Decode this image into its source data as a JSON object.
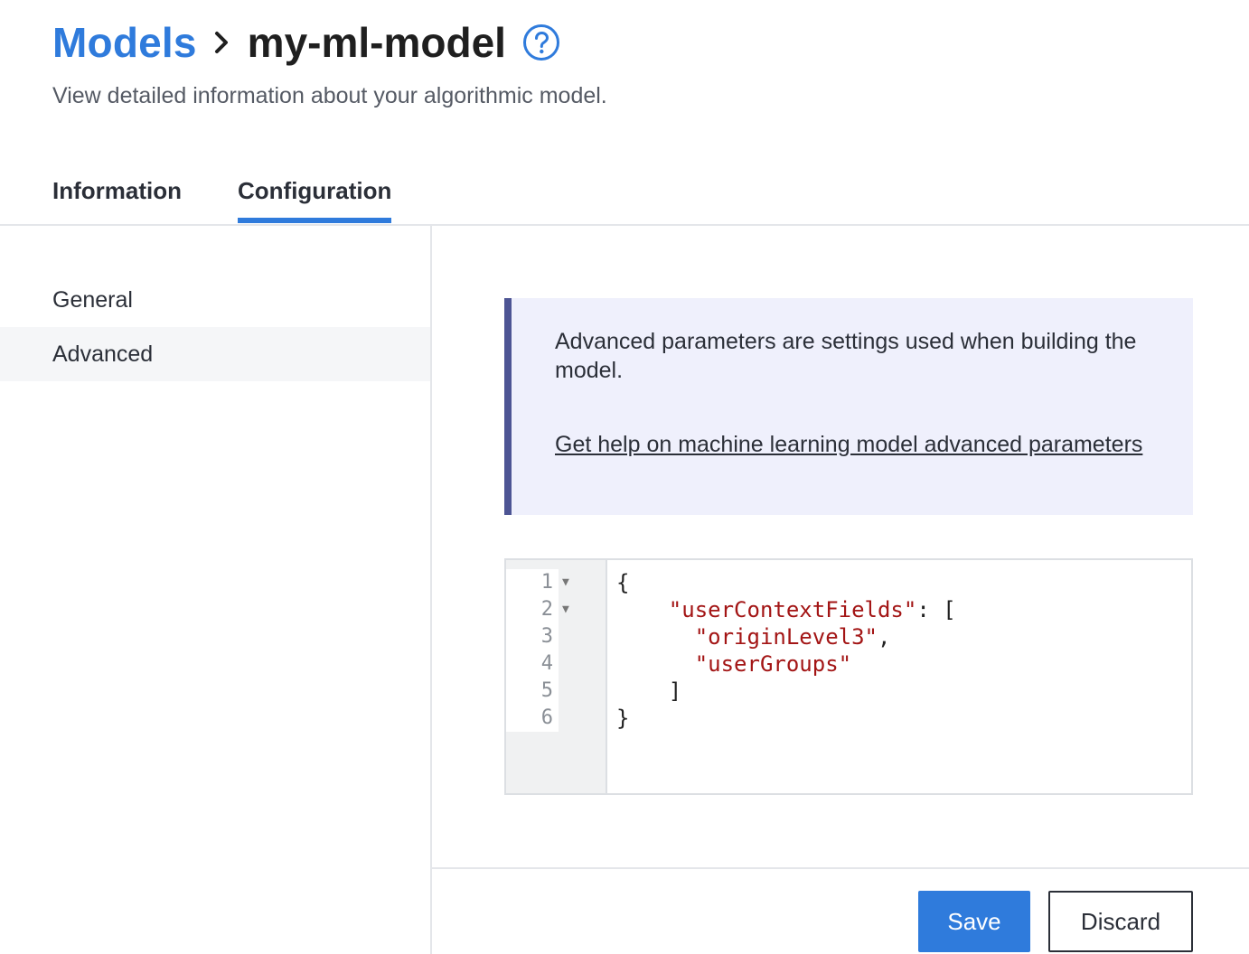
{
  "header": {
    "breadcrumb_root": "Models",
    "breadcrumb_current": "my-ml-model",
    "subtitle": "View detailed information about your algorithmic model."
  },
  "tabs": [
    {
      "label": "Information",
      "active": false
    },
    {
      "label": "Configuration",
      "active": true
    }
  ],
  "sidebar": {
    "items": [
      {
        "label": "General",
        "active": false
      },
      {
        "label": "Advanced",
        "active": true
      }
    ]
  },
  "callout": {
    "text": "Advanced parameters are settings used when building the model.",
    "link": "Get help on machine learning model advanced parameters"
  },
  "editor": {
    "line_numbers": [
      "1",
      "2",
      "3",
      "4",
      "5",
      "6"
    ],
    "lines": {
      "l1": "{",
      "l2_key": "\"userContextFields\"",
      "l2_rest": ": [",
      "l3_val": "\"originLevel3\"",
      "l3_rest": ",",
      "l4_val": "\"userGroups\"",
      "l5": "]",
      "l6": "}"
    }
  },
  "footer": {
    "save_label": "Save",
    "discard_label": "Discard"
  },
  "colors": {
    "accent": "#2f7bdc",
    "callout_bg": "#eff0fc",
    "callout_border": "#4d5594",
    "json_string": "#a31515"
  },
  "icons": {
    "breadcrumb_separator": "chevron-right-icon",
    "help": "help-circle-icon",
    "fold": "fold-arrow-icon"
  }
}
